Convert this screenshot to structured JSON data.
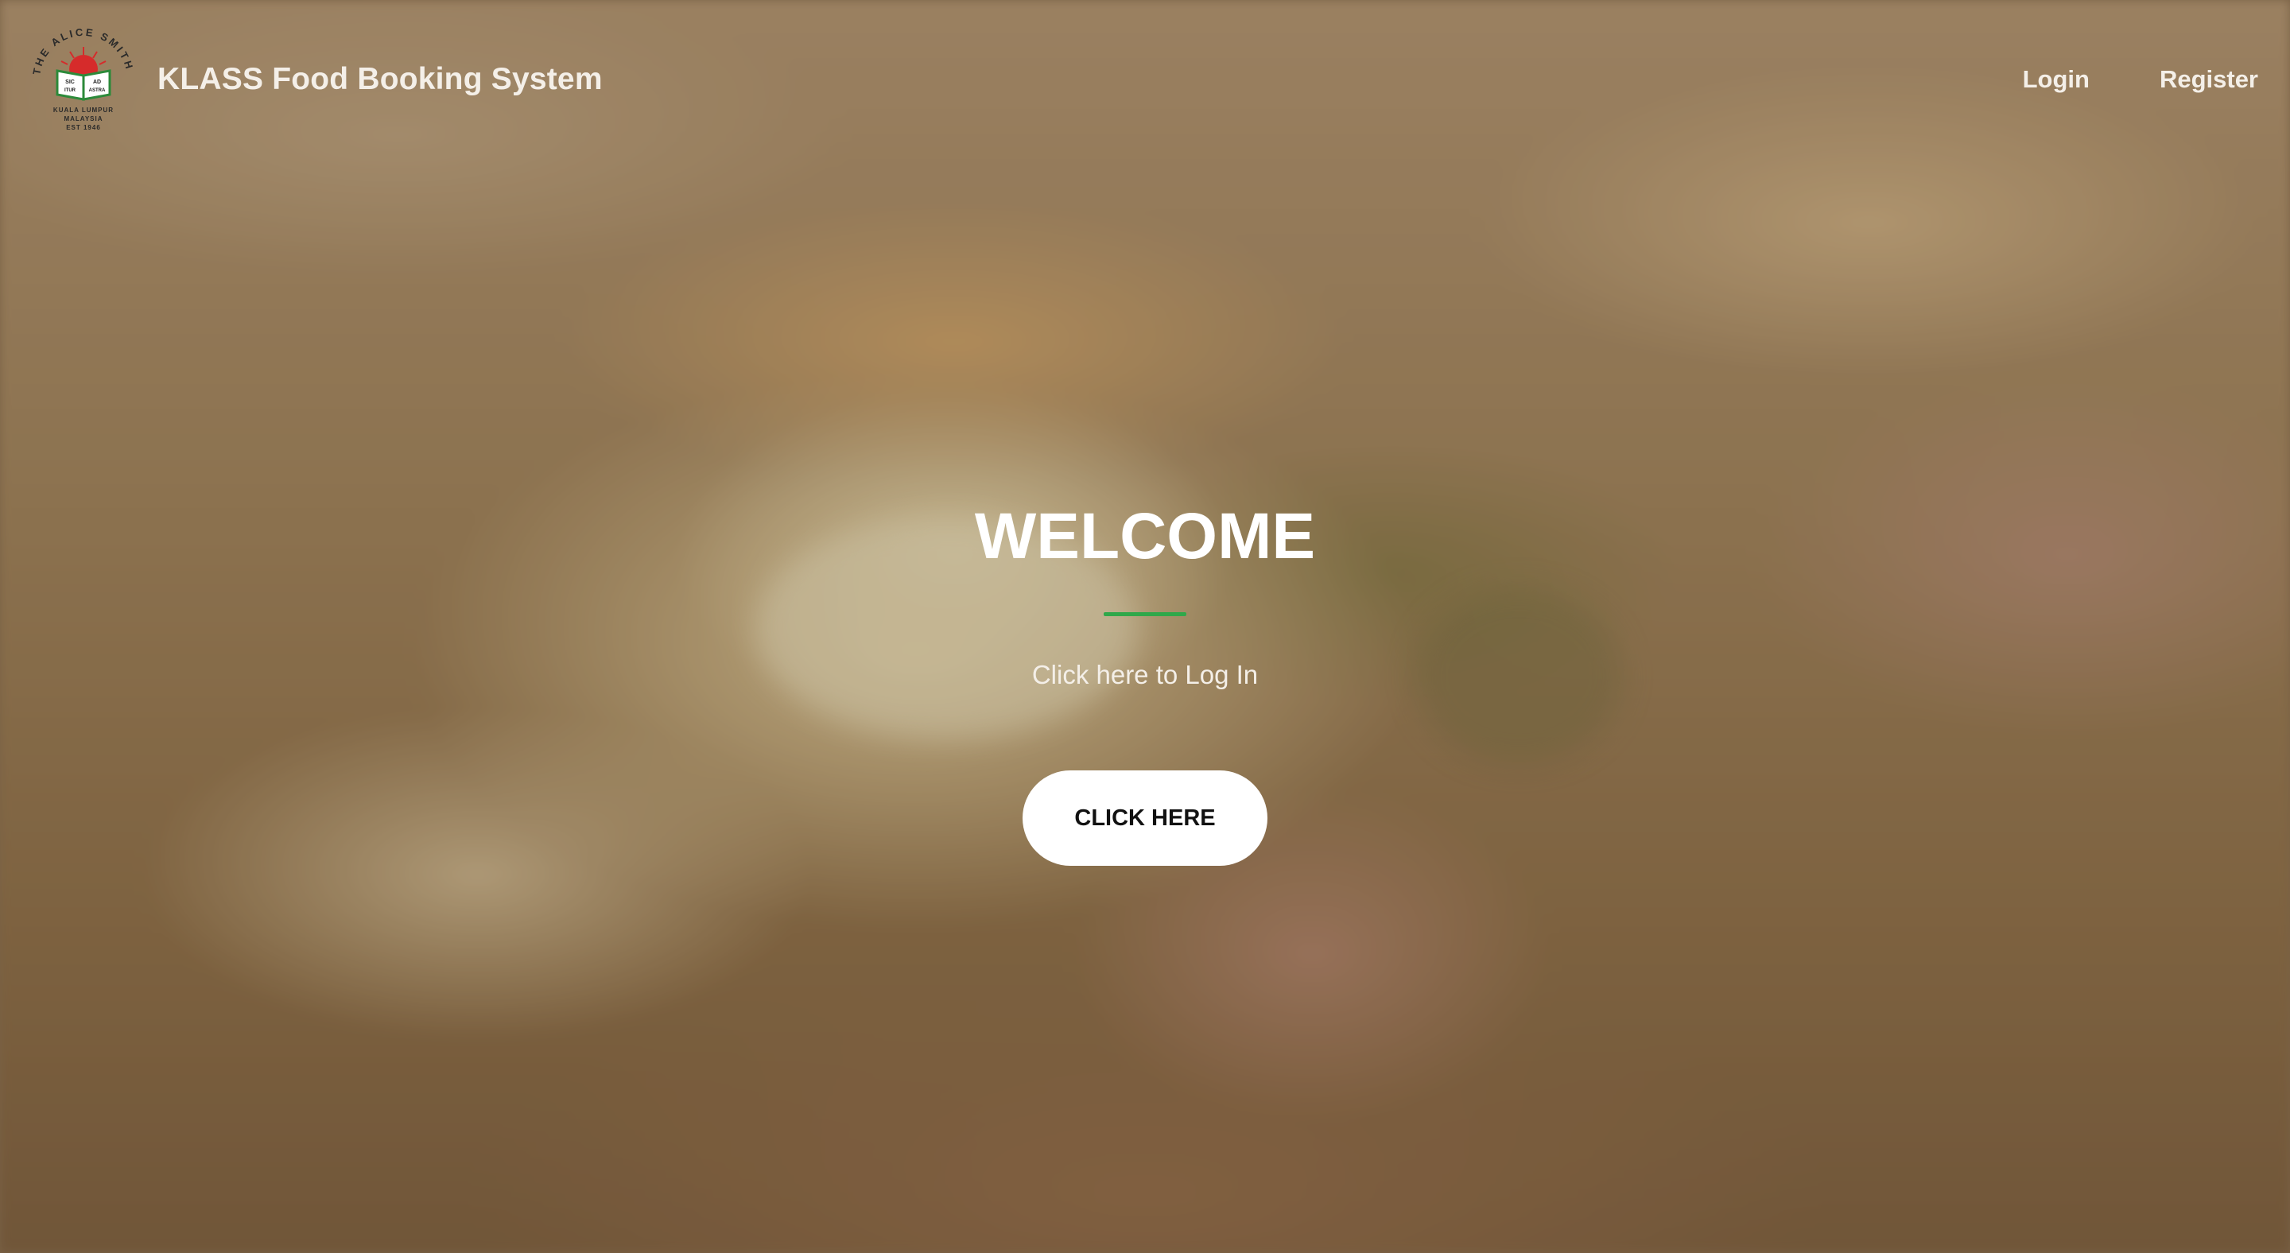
{
  "navbar": {
    "brand_title": "KLASS Food Booking System",
    "logo": {
      "icon": "school-crest-logo",
      "ring_text": "THE ALICE SMITH SCHOOL",
      "book_left_top": "SIC",
      "book_left_bottom": "ITUR",
      "book_right_top": "AD",
      "book_right_bottom": "ASTRA",
      "location_line1": "KUALA LUMPUR",
      "location_line2": "MALAYSIA",
      "established": "EST 1946"
    },
    "links": {
      "login": "Login",
      "register": "Register"
    }
  },
  "hero": {
    "title": "WELCOME",
    "subtitle": "Click here to Log In",
    "button_label": "CLICK HERE"
  },
  "colors": {
    "divider": "#2fa84a",
    "button_bg": "#ffffff",
    "text_light": "#f4efe8"
  }
}
